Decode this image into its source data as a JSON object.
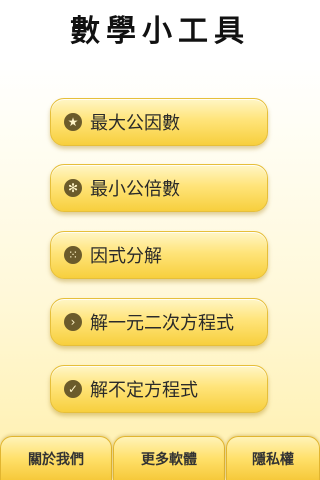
{
  "app": {
    "title": "數學小工具"
  },
  "menu": {
    "items": [
      {
        "label": "最大公因數",
        "icon": "star-icon",
        "glyph": "★"
      },
      {
        "label": "最小公倍數",
        "icon": "gear-icon",
        "glyph": "✻"
      },
      {
        "label": "因式分解",
        "icon": "grid-icon",
        "glyph": "⁙"
      },
      {
        "label": "解一元二次方程式",
        "icon": "chevron-right-icon",
        "glyph": "›"
      },
      {
        "label": "解不定方程式",
        "icon": "check-icon",
        "glyph": "✓"
      }
    ]
  },
  "bottom_bar": {
    "about": "關於我們",
    "more_apps": "更多軟體",
    "privacy": "隱私權"
  },
  "colors": {
    "button_top": "#fff6c6",
    "button_bottom": "#f7cf3d",
    "icon_bg": "#6b5b2b"
  }
}
